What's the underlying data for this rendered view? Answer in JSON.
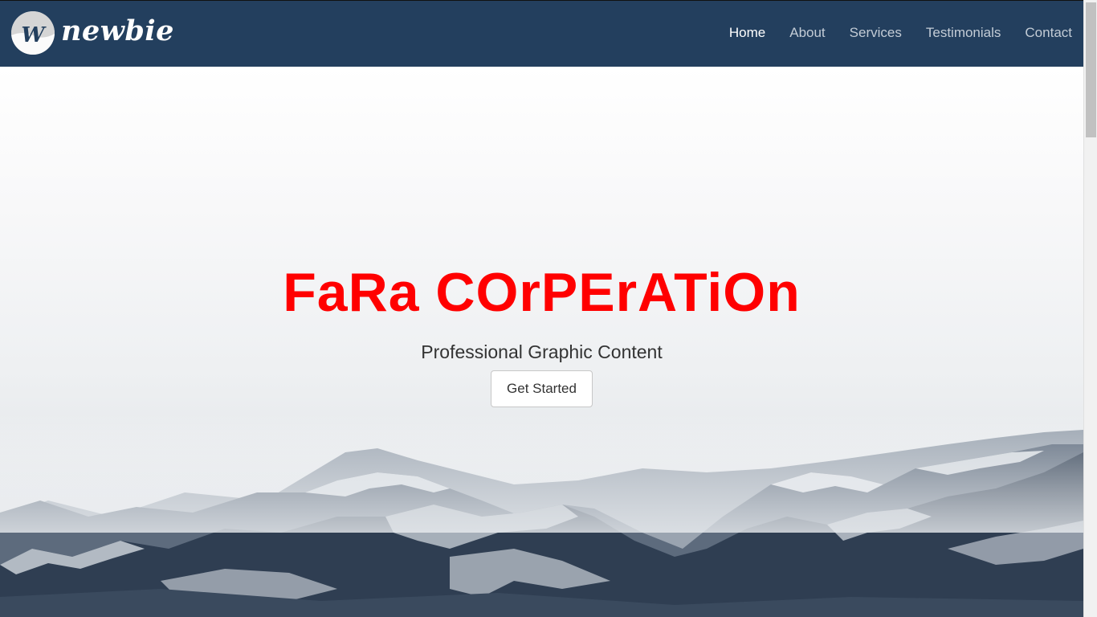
{
  "brand": {
    "name": "newbie",
    "badge_text": "W",
    "badge_icon": "logo-badge-icon"
  },
  "nav": {
    "items": [
      {
        "label": "Home",
        "active": true
      },
      {
        "label": "About",
        "active": false
      },
      {
        "label": "Services",
        "active": false
      },
      {
        "label": "Testimonials",
        "active": false
      },
      {
        "label": "Contact",
        "active": false
      }
    ]
  },
  "hero": {
    "title": "FaRa COrPErATiOn",
    "subtitle": "Professional Graphic Content",
    "cta_label": "Get Started",
    "background": "snowy-mountains-photo"
  },
  "colors": {
    "navbar": "#233f5e",
    "title": "#ff0000",
    "nav_active": "#ffffff",
    "nav_inactive": "#c3ccd6"
  }
}
